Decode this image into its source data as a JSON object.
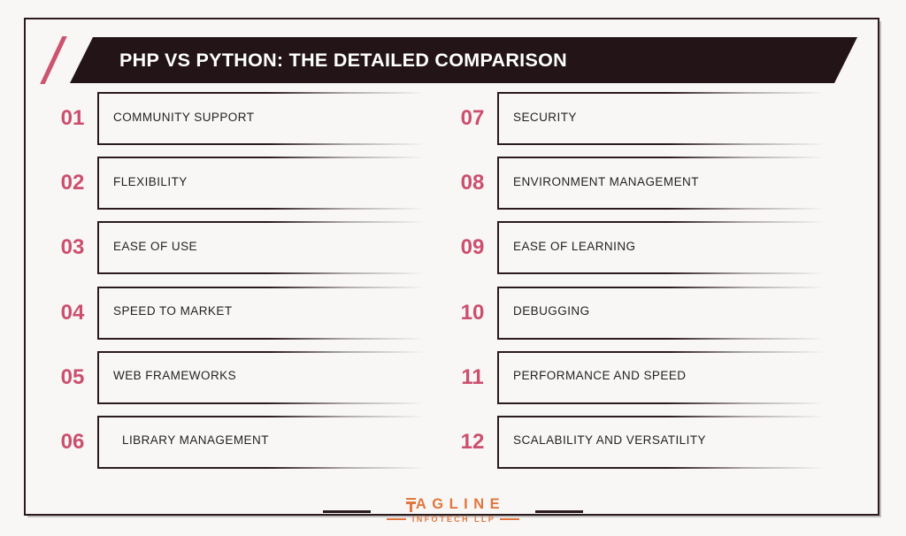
{
  "header": {
    "title": "PHP VS PYTHON: THE DETAILED COMPARISON",
    "accent_color": "#cc5470",
    "banner_color": "#231517"
  },
  "colors": {
    "background": "#f8f7f6",
    "number": "#cc4f6d",
    "text": "#231f20",
    "logo": "#e0773f",
    "frame": "#2b1b1d"
  },
  "left_column": [
    {
      "number": "01",
      "label": "COMMUNITY SUPPORT"
    },
    {
      "number": "02",
      "label": "FLEXIBILITY"
    },
    {
      "number": "03",
      "label": "EASE OF USE"
    },
    {
      "number": "04",
      "label": "SPEED TO MARKET"
    },
    {
      "number": "05",
      "label": "WEB FRAMEWORKS"
    },
    {
      "number": "06",
      "label": "LIBRARY MANAGEMENT"
    }
  ],
  "right_column": [
    {
      "number": "07",
      "label": "SECURITY"
    },
    {
      "number": "08",
      "label": "ENVIRONMENT MANAGEMENT"
    },
    {
      "number": "09",
      "label": "EASE OF LEARNING"
    },
    {
      "number": "10",
      "label": "DEBUGGING"
    },
    {
      "number": "11",
      "label": "PERFORMANCE AND SPEED"
    },
    {
      "number": "12",
      "label": "SCALABILITY AND VERSATILITY"
    }
  ],
  "footer": {
    "logo_name": "AGLINE",
    "logo_subtitle": "INFOTECH LLP"
  }
}
